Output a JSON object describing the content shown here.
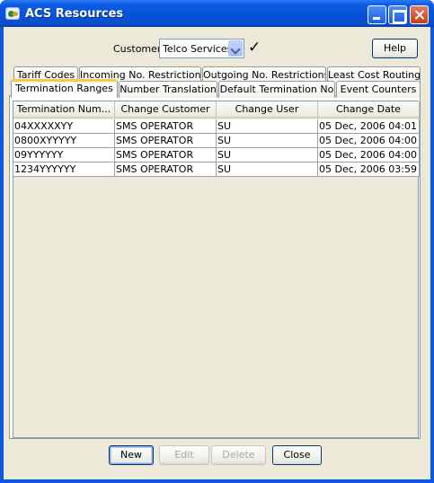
{
  "window": {
    "title": "ACS Resources"
  },
  "header": {
    "customer_label": "Customer",
    "customer_value": "Telco Services",
    "help_label": "Help"
  },
  "tabs": {
    "row1": [
      "Tariff Codes",
      "Incoming No. Restrictions",
      "Outgoing No. Restrictions",
      "Least Cost Routing"
    ],
    "row2": [
      "Termination Ranges",
      "Number Translation",
      "Default Termination No",
      "Event Counters"
    ],
    "active": "Termination Ranges"
  },
  "table": {
    "columns": [
      "Termination Num...",
      "Change Customer",
      "Change User",
      "Change Date"
    ],
    "rows": [
      [
        "04XXXXXYY",
        "SMS OPERATOR",
        "SU",
        "05 Dec, 2006 04:01"
      ],
      [
        "0800XYYYYY",
        "SMS OPERATOR",
        "SU",
        "05 Dec, 2006 04:00"
      ],
      [
        "09YYYYYY",
        "SMS OPERATOR",
        "SU",
        "05 Dec, 2006 04:00"
      ],
      [
        "1234YYYYYY",
        "SMS OPERATOR",
        "SU",
        "05 Dec, 2006 03:59"
      ]
    ]
  },
  "footer": {
    "new_label": "New",
    "edit_label": "Edit",
    "delete_label": "Delete",
    "close_label": "Close"
  },
  "colors": {
    "titlebar": "#0653d9",
    "face": "#ece9d8",
    "active_tab_accent": "#ffc83c"
  },
  "icons": [
    "app-icon",
    "minimize-icon",
    "maximize-icon",
    "close-icon",
    "dropdown-arrow-icon",
    "checkmark-icon"
  ]
}
